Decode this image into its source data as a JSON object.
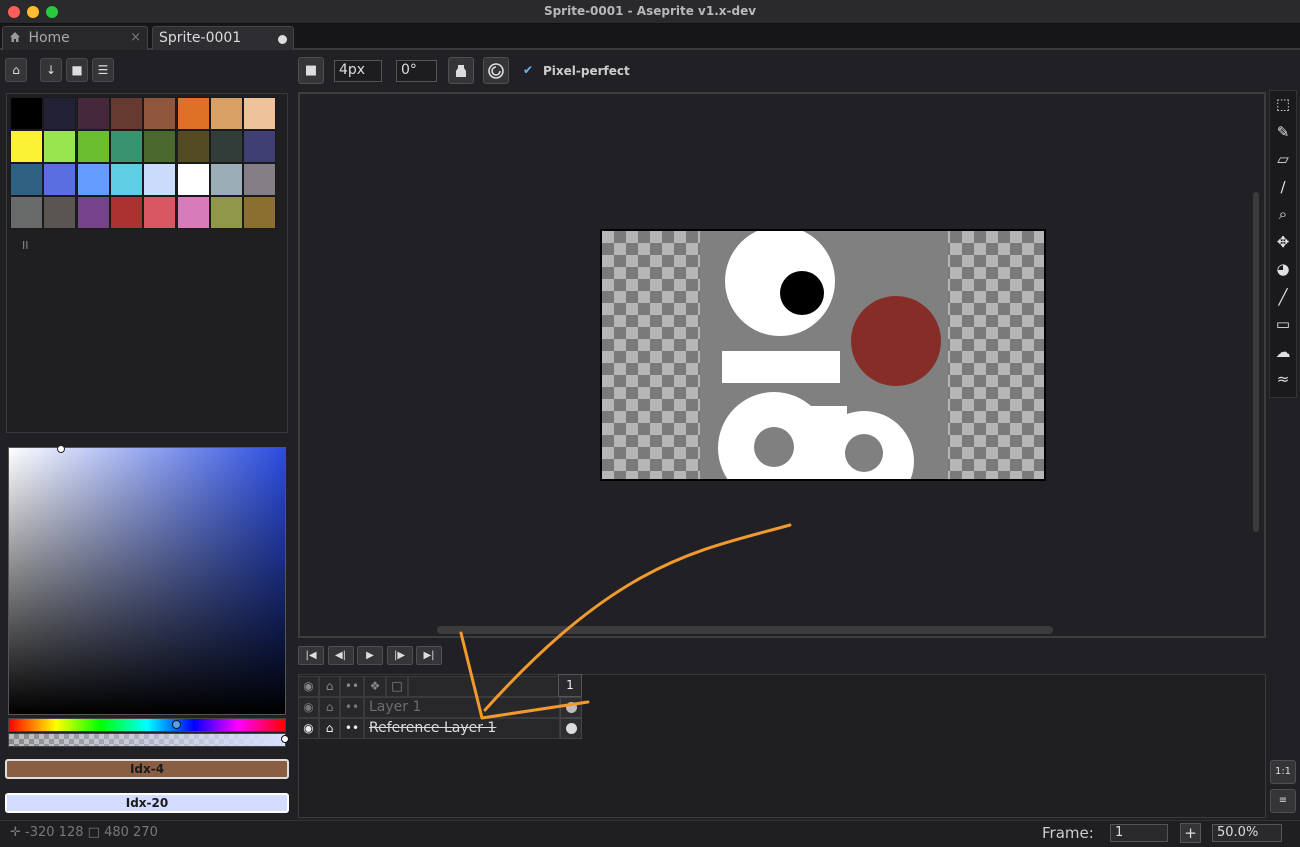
{
  "window": {
    "title": "Sprite-0001 - Aseprite v1.x-dev"
  },
  "tabs": [
    {
      "label": "Home",
      "icon": "home-icon",
      "close_glyph": "×"
    },
    {
      "label": "Sprite-0001",
      "modified": true
    }
  ],
  "left_toolbar": {
    "buttons": [
      {
        "name": "lock-icon",
        "glyph": "⌂"
      },
      {
        "name": "download-icon",
        "glyph": "↓"
      },
      {
        "name": "sort-icon",
        "glyph": "■"
      },
      {
        "name": "menu-icon",
        "glyph": "☰"
      }
    ]
  },
  "palette": {
    "colors": [
      "#000000",
      "#222034",
      "#45283c",
      "#663931",
      "#8f563b",
      "#df7126",
      "#d9a066",
      "#eec39a",
      "#fbf236",
      "#99e550",
      "#6abe30",
      "#37946e",
      "#4b692f",
      "#524b24",
      "#323c39",
      "#3f3f74",
      "#306082",
      "#5b6ee1",
      "#639bff",
      "#5fcde4",
      "#cbdbfc",
      "#ffffff",
      "#9badb7",
      "#847e87",
      "#696a6a",
      "#595652",
      "#76428a",
      "#ac3232",
      "#d95763",
      "#d77bba",
      "#8f974a",
      "#8a6f30"
    ],
    "handle": "II"
  },
  "color_bars": {
    "foreground": {
      "label": "Idx-4",
      "color": "#8a5e43"
    },
    "background": {
      "label": "Idx-20",
      "color": "#d4dcff"
    }
  },
  "context_bar": {
    "brush_size": "4px",
    "brush_angle": "0°",
    "pixel_perfect_label": "Pixel-perfect",
    "pixel_perfect_checked": true,
    "check_glyph": "✔"
  },
  "tools": [
    {
      "name": "marquee-select-icon",
      "glyph": "⬚"
    },
    {
      "name": "pencil-icon",
      "glyph": "✎"
    },
    {
      "name": "eraser-icon",
      "glyph": "▱"
    },
    {
      "name": "eyedropper-icon",
      "glyph": "∕"
    },
    {
      "name": "zoom-icon",
      "glyph": "⌕"
    },
    {
      "name": "move-icon",
      "glyph": "✥"
    },
    {
      "name": "paint-bucket-icon",
      "glyph": "◕"
    },
    {
      "name": "line-icon",
      "glyph": "╱"
    },
    {
      "name": "rectangle-icon",
      "glyph": "▭"
    },
    {
      "name": "contour-icon",
      "glyph": "☁"
    },
    {
      "name": "blur-icon",
      "glyph": "≈"
    }
  ],
  "side_buttons": [
    {
      "name": "actual-size-button",
      "label": "1:1"
    },
    {
      "name": "timeline-toggle-button",
      "label": "≡"
    }
  ],
  "animation_controls": [
    {
      "name": "first-frame-button",
      "glyph": "|◀"
    },
    {
      "name": "prev-frame-button",
      "glyph": "◀|"
    },
    {
      "name": "play-button",
      "glyph": "▶"
    },
    {
      "name": "next-frame-button",
      "glyph": "|▶"
    },
    {
      "name": "last-frame-button",
      "glyph": "▶|"
    }
  ],
  "timeline": {
    "frame_header": "1",
    "header_icons": [
      {
        "name": "visibility-header-icon",
        "glyph": "◉"
      },
      {
        "name": "lock-header-icon",
        "glyph": "⌂"
      },
      {
        "name": "continuous-header-icon",
        "glyph": "••"
      },
      {
        "name": "onion-skin-icon",
        "glyph": "❖"
      },
      {
        "name": "layer-mode-icon",
        "glyph": "□"
      }
    ],
    "layers": [
      {
        "name": "Layer 1",
        "dimmed": true
      },
      {
        "name": "Reference Layer 1",
        "strikethrough": true
      }
    ]
  },
  "status": {
    "coords": "-320 128",
    "size": "480 270",
    "frame_label": "Frame:",
    "frame_value": "1",
    "add_glyph": "+",
    "zoom": "50.0%"
  },
  "annotation": {
    "stroke_color": "#f29a2e"
  }
}
